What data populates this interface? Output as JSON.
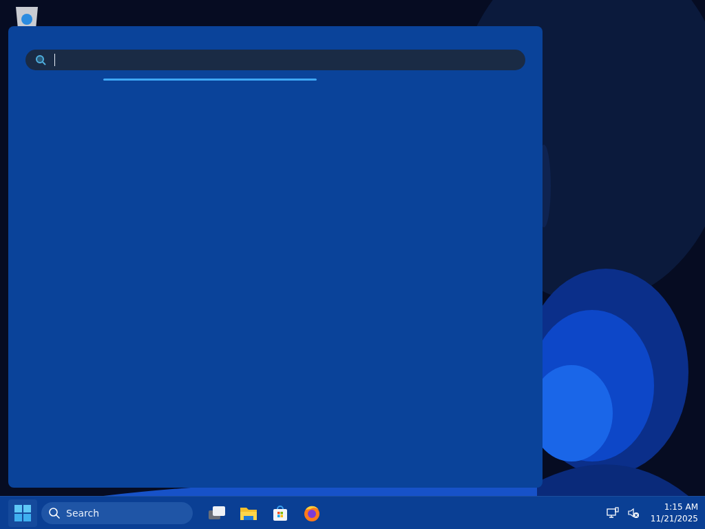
{
  "desktop": {
    "icons": [
      {
        "kind": "recycle-bin"
      }
    ]
  },
  "start_panel": {
    "search_field": {
      "focused": true
    }
  },
  "taskbar": {
    "search": {
      "placeholder": "Search"
    },
    "apps": [
      {
        "kind": "task-view"
      },
      {
        "kind": "file-explorer"
      },
      {
        "kind": "store"
      },
      {
        "kind": "browser"
      }
    ],
    "tray": [
      {
        "kind": "network"
      },
      {
        "kind": "volume-muted"
      }
    ],
    "clock": {
      "time": "1:15 AM",
      "date": "11/21/2025"
    }
  }
}
